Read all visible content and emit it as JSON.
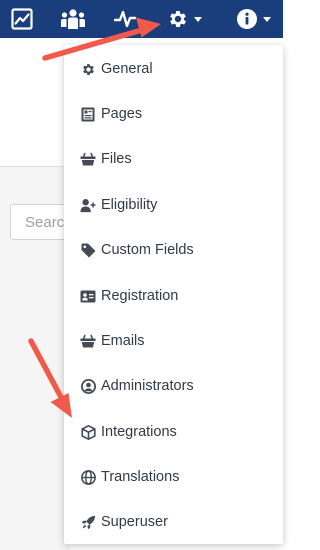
{
  "nav": {
    "items": [
      {
        "icon": "line-chart-icon"
      },
      {
        "icon": "users-icon"
      },
      {
        "icon": "activity-pulse-icon"
      },
      {
        "icon": "gear-icon",
        "caret": "chevron-down-icon"
      },
      {
        "icon": "info-circle-icon",
        "caret": "chevron-down-icon"
      }
    ]
  },
  "search": {
    "placeholder": "Search"
  },
  "dropdown": {
    "items": [
      {
        "label": "General",
        "icon": "gear-icon"
      },
      {
        "label": "Pages",
        "icon": "document-icon"
      },
      {
        "label": "Files",
        "icon": "basket-icon"
      },
      {
        "label": "Eligibility",
        "icon": "user-plus-icon"
      },
      {
        "label": "Custom Fields",
        "icon": "tag-icon"
      },
      {
        "label": "Registration",
        "icon": "id-card-icon"
      },
      {
        "label": "Emails",
        "icon": "basket-icon"
      },
      {
        "label": "Administrators",
        "icon": "user-circle-icon"
      },
      {
        "label": "Integrations",
        "icon": "cube-icon"
      },
      {
        "label": "Translations",
        "icon": "globe-icon"
      },
      {
        "label": "Superuser",
        "icon": "rocket-icon"
      }
    ]
  },
  "colors": {
    "navbar": "#1a3d7c",
    "annotation_arrow": "#f05a4a",
    "menu_text": "#333a45"
  }
}
